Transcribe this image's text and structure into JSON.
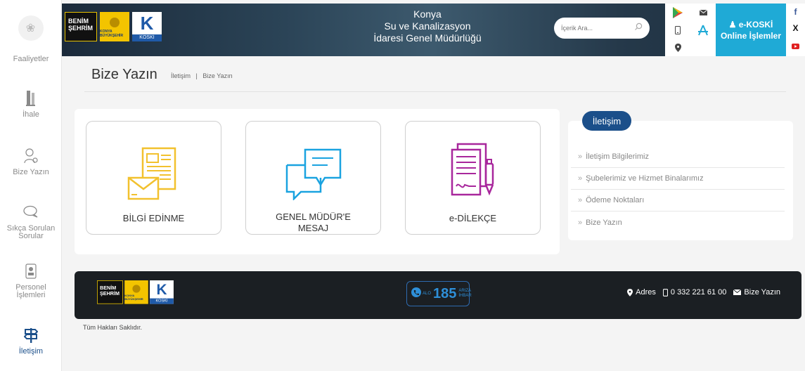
{
  "sidebar": {
    "top_label": "Faaliyetler",
    "items": [
      {
        "label": "İhale",
        "icon": "bookmark-icon"
      },
      {
        "label": "Bize Yazın",
        "icon": "paperclip-icon"
      },
      {
        "label": "Sıkça Sorulan Sorular",
        "icon": "chat-bubble-icon"
      },
      {
        "label": "Personel İşlemleri",
        "icon": "id-badge-icon"
      },
      {
        "label": "İletişim",
        "icon": "signpost-icon"
      }
    ]
  },
  "header": {
    "logo_benim": "BENİM ŞEHRİM",
    "logo_kbb": "KONYA BÜYÜKŞEHİR",
    "logo_koski": "KOSKİ",
    "title_line1": "Konya",
    "title_line2": "Su ve Kanalizasyon",
    "title_line3": "İdaresi Genel Müdürlüğü",
    "search_placeholder": "İçerik Ara...",
    "ekoski_line1": "e-KOSKİ",
    "ekoski_line2": "Online İşlemler"
  },
  "page": {
    "title": "Bize Yazın",
    "breadcrumb_1": "İletişim",
    "breadcrumb_sep": "|",
    "breadcrumb_2": "Bize Yazın"
  },
  "cards": [
    {
      "label": "BİLGİ EDİNME",
      "color": "#f2c12e"
    },
    {
      "label": "GENEL MÜDÜR'E MESAJ",
      "color": "#1aa3e0"
    },
    {
      "label": "e-DİLEKÇE",
      "color": "#a8279c"
    }
  ],
  "menu": {
    "title": "İletişim",
    "items": [
      "İletişim Bilgilerimiz",
      "Şubelerimiz ve Hizmet Binalarımız",
      "Ödeme Noktaları",
      "Bize Yazın"
    ]
  },
  "footer": {
    "alo_top": "ALO",
    "alo_number": "185",
    "alo_side_1": "ARIZA",
    "alo_side_2": "İHBAR",
    "address_label": "Adres",
    "phone": "0 332 221 61 00",
    "contact_label": "Bize Yazın",
    "copyright": "Tüm Hakları Saklıdır."
  },
  "colors": {
    "brand_blue": "#1b4f8a",
    "ekoski_blue": "#1faad6",
    "footer_dark": "#1b1f23"
  }
}
